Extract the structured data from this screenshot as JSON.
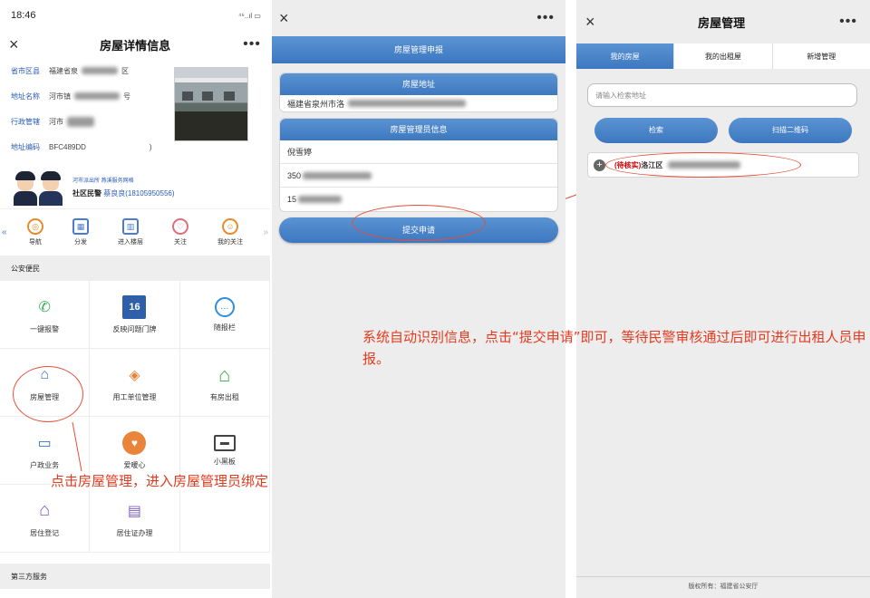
{
  "colors": {
    "accent": "#3d77bf",
    "annotation": "#e23a1f",
    "pending": "#cc0000"
  },
  "panel1": {
    "status_time": "18:46",
    "status_icons": "⁴⁶..ıl ▭",
    "title": "房屋详情信息",
    "close_icon": "×",
    "more_icon": "•••",
    "info": [
      {
        "k": "省市区县",
        "v": "福建省泉",
        "v2": "区"
      },
      {
        "k": "地址名称",
        "v": "河市镇",
        "v2": "号"
      },
      {
        "k": "行政管辖",
        "v": "河市",
        "v2": ""
      },
      {
        "k": "地址编码",
        "v": "BFC489DD",
        "v2": ")"
      }
    ],
    "police_unit": "河市派出所   燕溪服务网格",
    "police_label": "社区民警",
    "police_name": "蔡良良(18105950556)",
    "quick": [
      {
        "label": "导航",
        "icon": "navigation-icon"
      },
      {
        "label": "分发",
        "icon": "qrcode-icon"
      },
      {
        "label": "进入楼层",
        "icon": "building-icon"
      },
      {
        "label": "关注",
        "icon": "heart-icon"
      },
      {
        "label": "我的关注",
        "icon": "user-icon"
      }
    ],
    "section1": "公安便民",
    "grid": [
      {
        "label": "一键报警",
        "icon": "phone-icon"
      },
      {
        "label": "反映问题门牌",
        "icon": "calendar-16-icon",
        "num": "16"
      },
      {
        "label": "随报栏",
        "icon": "chat-icon"
      },
      {
        "label": "房屋管理",
        "icon": "house-manage-icon"
      },
      {
        "label": "用工单位管理",
        "icon": "tag-icon"
      },
      {
        "label": "有房出租",
        "icon": "house-icon"
      },
      {
        "label": "户政业务",
        "icon": "card-icon"
      },
      {
        "label": "爱暖心",
        "icon": "love-icon"
      },
      {
        "label": "小黑板",
        "icon": "board-icon"
      },
      {
        "label": "居住登记",
        "icon": "house-register-icon"
      },
      {
        "label": "居住证办理",
        "icon": "document-icon"
      },
      {
        "label": "",
        "icon": ""
      }
    ],
    "section2": "第三方服务",
    "annotation": "点击房屋管理，进入房屋管理员绑定"
  },
  "panel2": {
    "close_icon": "×",
    "more_icon": "•••",
    "title": "房屋管理申报",
    "address_header": "房屋地址",
    "address_value": "福建省泉州市洛",
    "admin_header": "房屋管理员信息",
    "admin_rows": [
      "倪雪婷",
      "350",
      "15"
    ],
    "submit": "提交申请"
  },
  "panel3": {
    "close_icon": "×",
    "more_icon": "•••",
    "title": "房屋管理",
    "tabs": [
      "我的房屋",
      "我的出租屋",
      "新增管理"
    ],
    "search_placeholder": "请输入检索地址",
    "btn_search": "检索",
    "btn_scan": "扫描二维码",
    "record_status": "(待核实)",
    "record_addr": "洛江区",
    "footer": "版权所有：福建省公安厅"
  },
  "annotation_main": "系统自动识别信息，点击“提交申请”即可，等待民警审核通过后即可进行出租人员申报。"
}
